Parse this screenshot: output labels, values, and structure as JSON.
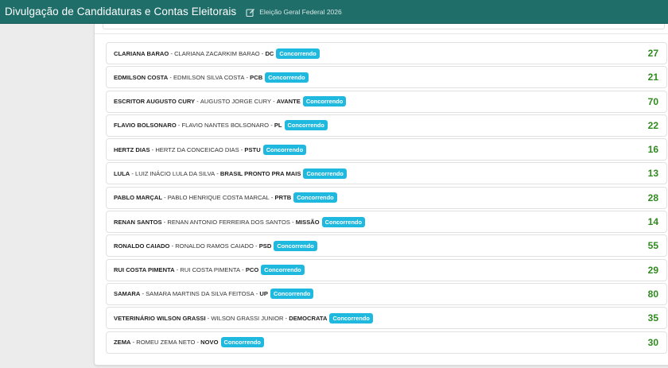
{
  "header": {
    "title": "Divulgação de Candidaturas e Contas Eleitorais",
    "election_label": "Eleição Geral Federal 2026",
    "icon": "edit-icon"
  },
  "colors": {
    "header_bg": "#1f6e6a",
    "badge": "#1fb8de",
    "number": "#2f8a1e"
  },
  "sep": " - ",
  "candidates": [
    {
      "name": "CLARIANA BARAO",
      "full_name": "CLARIANA ZACARKIM BARAO",
      "party": "DC",
      "status": "Concorrendo",
      "number": "27"
    },
    {
      "name": "EDMILSON COSTA",
      "full_name": "EDMILSON SILVA COSTA",
      "party": "PCB",
      "status": "Concorrendo",
      "number": "21"
    },
    {
      "name": "ESCRITOR AUGUSTO CURY",
      "full_name": "AUGUSTO JORGE CURY",
      "party": "AVANTE",
      "status": "Concorrendo",
      "number": "70"
    },
    {
      "name": "FLAVIO BOLSONARO",
      "full_name": "FLAVIO NANTES BOLSONARO",
      "party": "PL",
      "status": "Concorrendo",
      "number": "22"
    },
    {
      "name": "HERTZ DIAS",
      "full_name": "HERTZ DA CONCEICAO DIAS",
      "party": "PSTU",
      "status": "Concorrendo",
      "number": "16"
    },
    {
      "name": "LULA",
      "full_name": "LUIZ INÁCIO LULA DA SILVA",
      "party": "BRASIL PRONTO PRA MAIS",
      "status": "Concorrendo",
      "number": "13"
    },
    {
      "name": "PABLO MARÇAL",
      "full_name": "PABLO HENRIQUE COSTA MARCAL",
      "party": "PRTB",
      "status": "Concorrendo",
      "number": "28"
    },
    {
      "name": "RENAN SANTOS",
      "full_name": "RENAN ANTONIO FERREIRA DOS SANTOS",
      "party": "MISSÃO",
      "status": "Concorrendo",
      "number": "14"
    },
    {
      "name": "RONALDO CAIADO",
      "full_name": "RONALDO RAMOS CAIADO",
      "party": "PSD",
      "status": "Concorrendo",
      "number": "55"
    },
    {
      "name": "RUI COSTA PIMENTA",
      "full_name": "RUI COSTA PIMENTA",
      "party": "PCO",
      "status": "Concorrendo",
      "number": "29"
    },
    {
      "name": "SAMARA",
      "full_name": "SAMARA MARTINS DA SILVA FEITOSA",
      "party": "UP",
      "status": "Concorrendo",
      "number": "80"
    },
    {
      "name": "VETERINÁRIO WILSON GRASSI",
      "full_name": "WILSON GRASSI JUNIOR",
      "party": "DEMOCRATA",
      "status": "Concorrendo",
      "number": "35"
    },
    {
      "name": "ZEMA",
      "full_name": "ROMEU ZEMA NETO",
      "party": "NOVO",
      "status": "Concorrendo",
      "number": "30"
    }
  ]
}
